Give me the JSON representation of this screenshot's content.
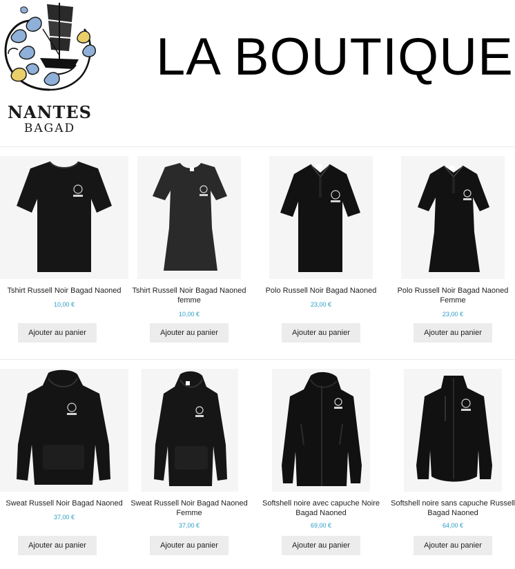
{
  "brand": {
    "line1": "NANTES",
    "line2": "BAGAD"
  },
  "page_title": "LA BOUTIQUE",
  "products": [
    {
      "name": "Tshirt Russell Noir Bagad Naoned",
      "price": "10,00 €",
      "button": "Ajouter au panier",
      "icon": "tshirt-icon"
    },
    {
      "name": "Tshirt Russell Noir Bagad Naoned femme",
      "price": "10,00 €",
      "button": "Ajouter au panier",
      "icon": "tshirt-women-icon"
    },
    {
      "name": "Polo Russell Noir Bagad Naoned",
      "price": "23,00 €",
      "button": "Ajouter au panier",
      "icon": "polo-icon"
    },
    {
      "name": "Polo Russell Noir Bagad Naoned Femme",
      "price": "23,00 €",
      "button": "Ajouter au panier",
      "icon": "polo-women-icon"
    },
    {
      "name": "Sweat Russell Noir Bagad Naoned",
      "price": "37,00 €",
      "button": "Ajouter au panier",
      "icon": "hoodie-icon"
    },
    {
      "name": "Sweat Russell Noir Bagad Naoned Femme",
      "price": "37,00 €",
      "button": "Ajouter au panier",
      "icon": "hoodie-women-icon"
    },
    {
      "name": "Softshell noire avec capuche Noire Bagad Naoned",
      "price": "69,00 €",
      "button": "Ajouter au panier",
      "icon": "softshell-hood-icon"
    },
    {
      "name": "Softshell noire sans capuche Russell Bagad Naoned",
      "price": "64,00 €",
      "button": "Ajouter au panier",
      "icon": "softshell-icon"
    }
  ],
  "colors": {
    "price": "#2a9dc5",
    "button_bg": "#ececec",
    "garment": "#161616"
  }
}
